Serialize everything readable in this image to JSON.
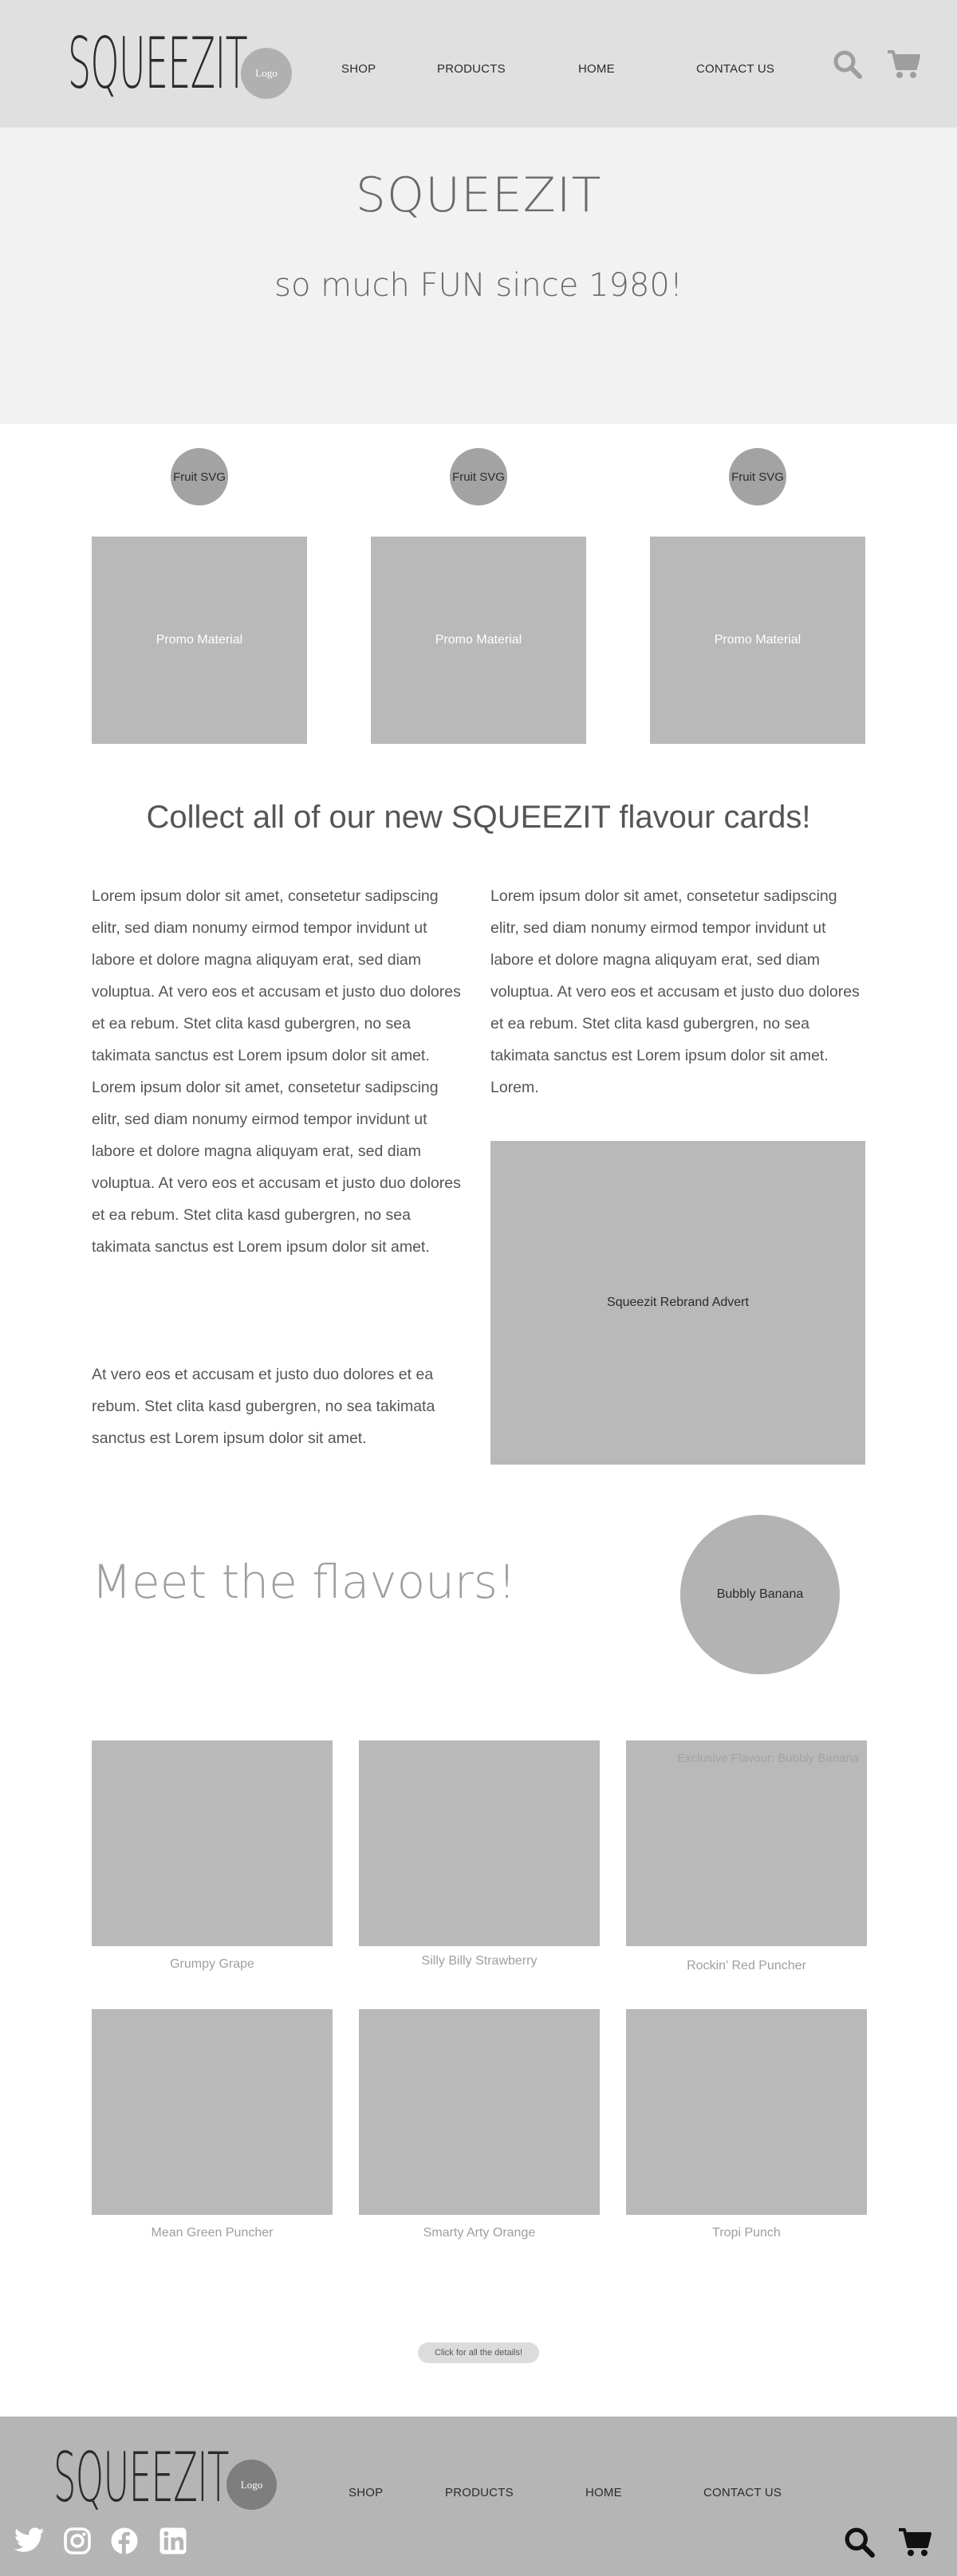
{
  "header": {
    "brand": "SQUEEZIT",
    "logo_label": "Logo",
    "nav": [
      "SHOP",
      "PRODUCTS",
      "HOME",
      "CONTACT US"
    ],
    "icons": [
      "search-icon",
      "cart-icon"
    ]
  },
  "hero": {
    "title": "SQUEEZIT",
    "subtitle": "so much FUN since 1980!"
  },
  "promo": {
    "fruit_labels": [
      "Fruit SVG",
      "Fruit SVG",
      "Fruit SVG"
    ],
    "box_labels": [
      "Promo Material",
      "Promo Material",
      "Promo Material"
    ]
  },
  "cards_section": {
    "heading": "Collect all of our new SQUEEZIT flavour cards!",
    "left_para_1": "Lorem ipsum dolor sit amet, consetetur sadipscing elitr, sed diam nonumy eirmod tempor invidunt ut labore et dolore magna aliquyam erat, sed diam voluptua. At vero eos et accusam et justo duo dolores et ea rebum. Stet clita kasd gubergren, no sea takimata sanctus est Lorem ipsum dolor sit amet. Lorem ipsum dolor sit amet, consetetur sadipscing elitr, sed diam nonumy eirmod tempor invidunt ut labore et dolore magna aliquyam erat, sed diam voluptua. At vero eos et accusam et justo duo dolores et ea rebum. Stet clita kasd gubergren, no sea takimata sanctus est Lorem ipsum dolor sit amet.",
    "left_para_2": "At vero eos et accusam et justo duo dolores et ea rebum. Stet clita kasd gubergren, no sea takimata sanctus est Lorem ipsum dolor sit amet.",
    "right_para": "Lorem ipsum dolor sit amet, consetetur sadipscing elitr, sed diam nonumy eirmod tempor invidunt ut labore et dolore magna aliquyam erat, sed diam voluptua. At vero eos et accusam et justo duo dolores et ea rebum. Stet clita kasd gubergren, no sea takimata sanctus est Lorem ipsum dolor sit amet. Lorem.",
    "advert_label": "Squeezit Rebrand Advert"
  },
  "flavours": {
    "heading": "Meet the flavours!",
    "featured_label": "Bubbly Banana",
    "exclusive_label": "Exclusive Flavour: Bubbly Banana",
    "items": [
      "Grumpy Grape",
      "Silly Billy Strawberry",
      "Rockin' Red Puncher",
      "Mean Green Puncher",
      "Smarty Arty Orange",
      "Tropi Punch"
    ]
  },
  "details_button": "Click for all the details!",
  "footer": {
    "brand": "SQUEEZIT",
    "logo_label": "Logo",
    "nav": [
      "SHOP",
      "PRODUCTS",
      "HOME",
      "CONTACT US"
    ],
    "social_icons": [
      "twitter-icon",
      "instagram-icon",
      "facebook-icon",
      "linkedin-icon"
    ],
    "icons": [
      "search-icon",
      "cart-icon"
    ]
  }
}
